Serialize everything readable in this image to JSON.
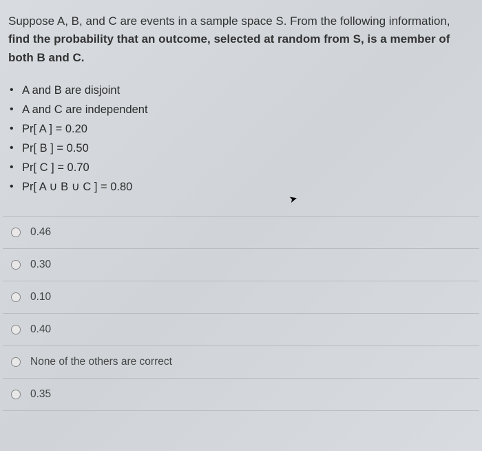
{
  "question": {
    "intro": "Suppose A, B, and C are events in a sample space S.  From the following information, ",
    "bold": "find the probability that an outcome, selected at random from S, is a member of both B and C."
  },
  "bullets": [
    "A and B are disjoint",
    "A and C are independent",
    "Pr[ A ] =  0.20",
    "Pr[ B ] =  0.50",
    "Pr[ C ] =  0.70",
    "Pr[ A ∪ B ∪ C ] =  0.80"
  ],
  "options": [
    "0.46",
    "0.30",
    "0.10",
    "0.40",
    "None of the others are correct",
    "0.35"
  ]
}
